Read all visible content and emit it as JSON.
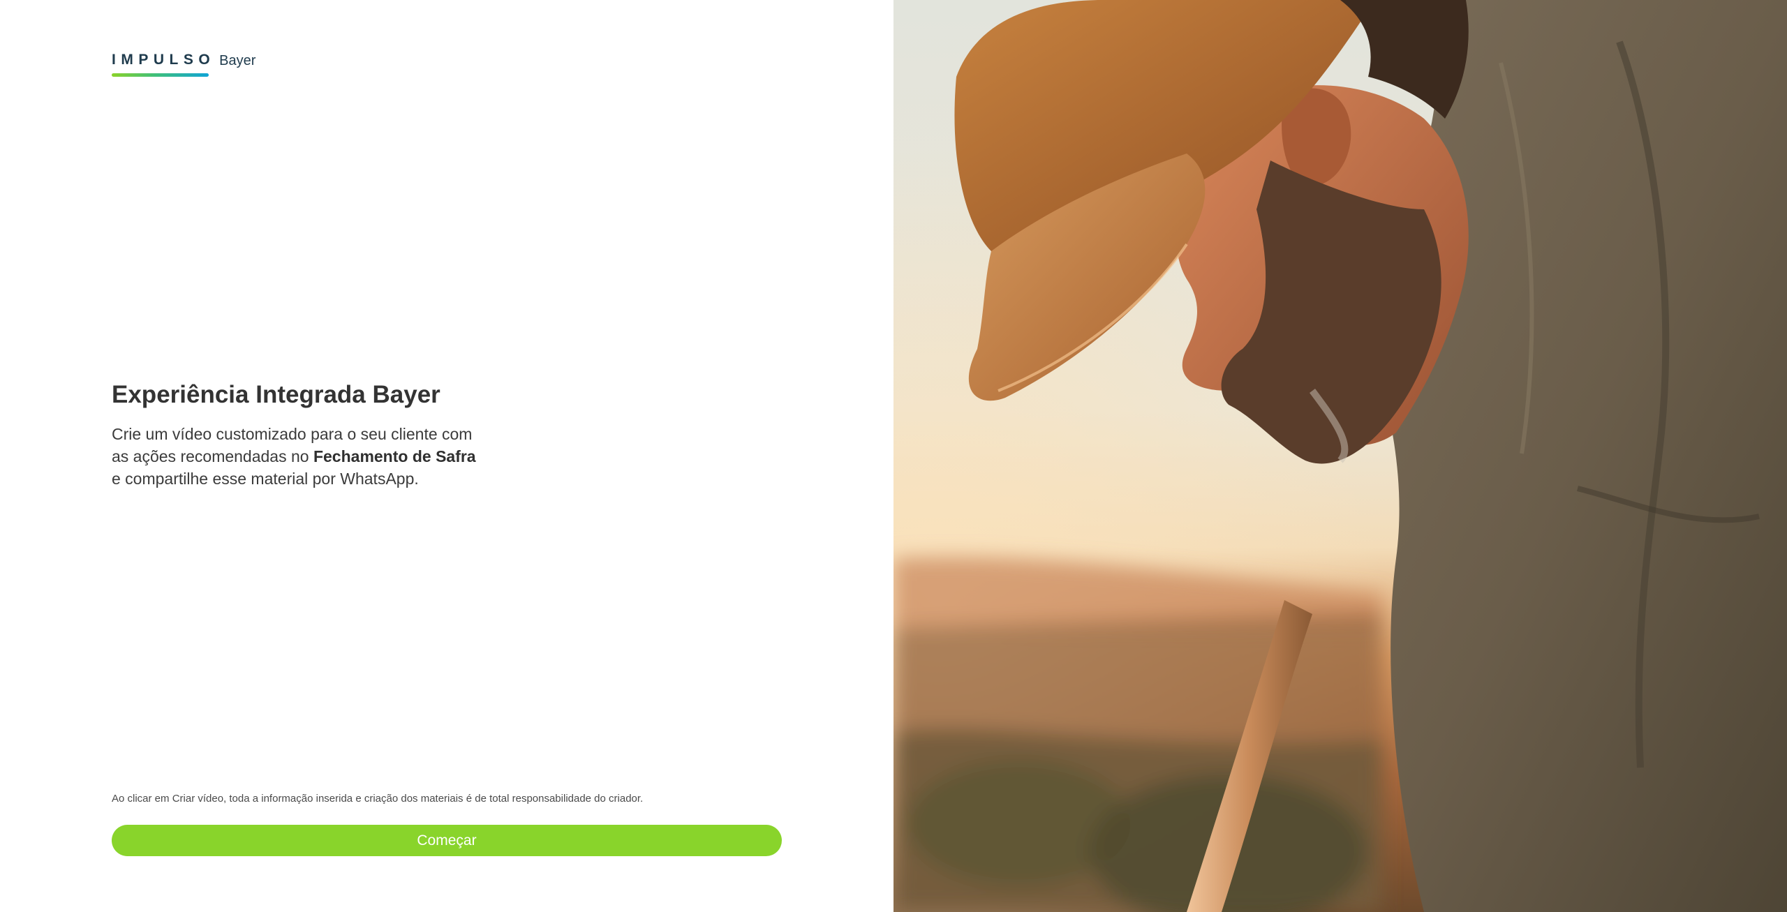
{
  "logo": {
    "wordmark": "IMPULSO",
    "brand": "Bayer"
  },
  "hero": {
    "title": "Experiência Integrada Bayer",
    "description_line1": "Crie um vídeo customizado para o seu cliente com",
    "description_line2_prefix": "as ações recomendadas no ",
    "description_line2_bold": "Fechamento de Safra",
    "description_line3": "e compartilhe esse material por WhatsApp."
  },
  "footer": {
    "disclaimer": "Ao clicar em Criar vídeo, toda a informação inserida e criação dos materiais é de total responsabilidade do criador.",
    "start_button_label": "Começar"
  },
  "colors": {
    "accent_green": "#89d42b",
    "logo_blue": "#1f3b4d",
    "underline_gradient": [
      "#8bd32a",
      "#10a4d6"
    ]
  }
}
